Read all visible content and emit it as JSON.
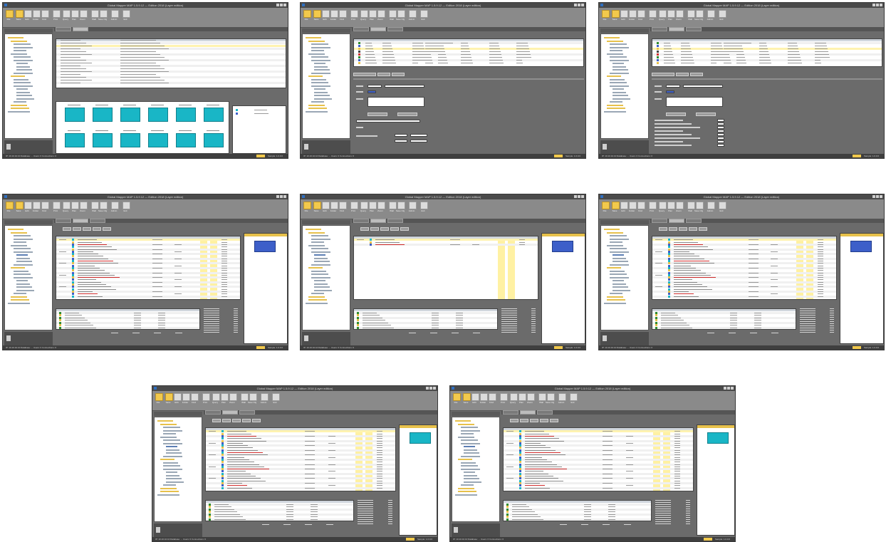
{
  "app": {
    "title": "Global Mapper MAP 1.5.9.12 — Edition 2018 (Layer edition)"
  },
  "ribbon": {
    "groups": [
      "File",
      "Save",
      "Edit",
      "Folder",
      "Find",
      "Print",
      "Query",
      "Plan",
      "Zoom",
      "Wall",
      "Save Cfg",
      "Admin",
      "Exit"
    ]
  },
  "tree": {
    "header": "Collection"
  },
  "status": {
    "left": "IP: 10.10.10.10 Database: ... Users: 0 Connections: 0",
    "right": "Rb: Test",
    "right2": "Sample: 1.0.0.0"
  },
  "colors": {
    "accent_cal": "#19b6c6",
    "accent_blue": "#3d5fc9",
    "highlight": "#fff3b0",
    "frame": "#6b6b6b"
  }
}
